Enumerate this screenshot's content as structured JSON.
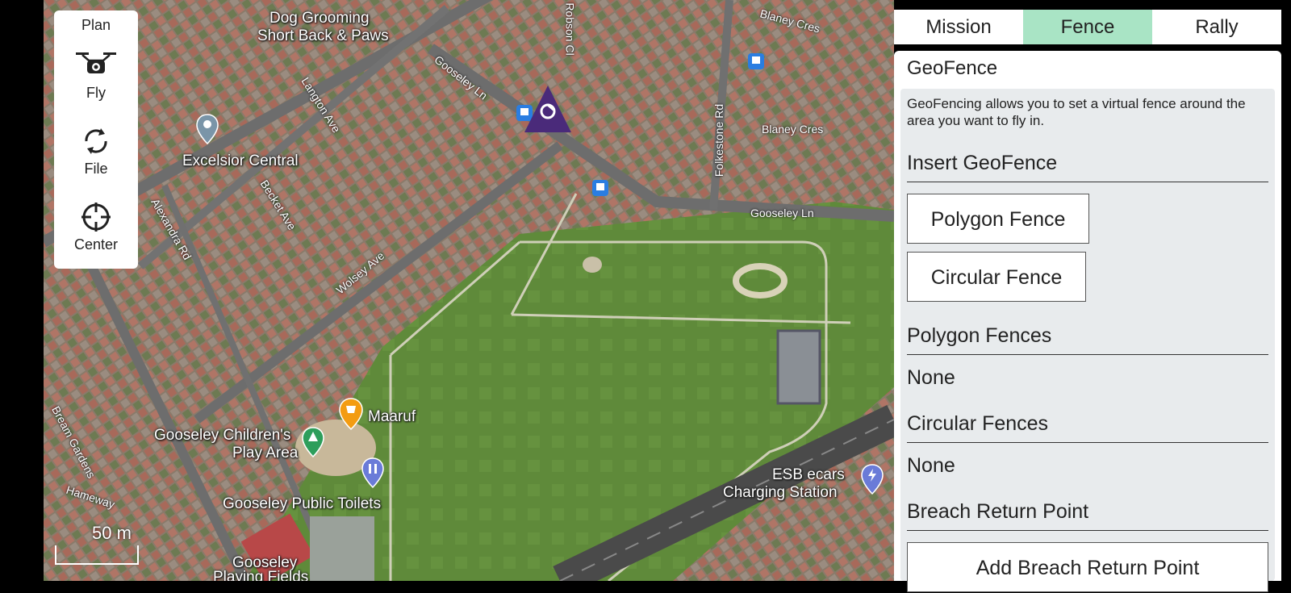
{
  "toolbar": {
    "plan_label": "Plan",
    "fly_label": "Fly",
    "file_label": "File",
    "center_label": "Center"
  },
  "map": {
    "scale_label": "50 m",
    "labels": {
      "dog_grooming_1": "Dog Grooming",
      "dog_grooming_2": "Short Back & Paws",
      "excelsior": "Excelsior Central",
      "maaruf": "Maaruf",
      "play_area_1": "Gooseley Children's",
      "play_area_2": "Play Area",
      "toilets": "Gooseley Public Toilets",
      "playing_fields_1": "Gooseley",
      "playing_fields_2": "Playing Fields",
      "esb_1": "ESB ecars",
      "esb_2": "Charging Station"
    },
    "streets": {
      "gooseley_ln_1": "Gooseley Ln",
      "gooseley_ln_2": "Gooseley Ln",
      "langton_ave": "Langton Ave",
      "becket_ave": "Becket Ave",
      "alexandra_rd": "Alexandra Rd",
      "wolsey_ave": "Wolsey Ave",
      "blaney_cres_1": "Blaney Cres",
      "blaney_cres_2": "Blaney Cres",
      "folkestone_rd": "Folkestone Rd",
      "robson_cl": "Robson Cl",
      "bream_gardens": "Bream Gardens",
      "hameway": "Hameway"
    }
  },
  "tabs": {
    "mission": "Mission",
    "fence": "Fence",
    "rally": "Rally"
  },
  "panel": {
    "title": "GeoFence",
    "description": "GeoFencing allows you to set a virtual fence around the area you want to fly in.",
    "insert_heading": "Insert GeoFence",
    "polygon_button": "Polygon Fence",
    "circular_button": "Circular Fence",
    "polygon_heading": "Polygon Fences",
    "polygon_value": "None",
    "circular_heading": "Circular Fences",
    "circular_value": "None",
    "breach_heading": "Breach Return Point",
    "breach_button": "Add Breach Return Point"
  },
  "colors": {
    "active_tab": "#a9e4c5",
    "vehicle": "#4a2a7a"
  }
}
